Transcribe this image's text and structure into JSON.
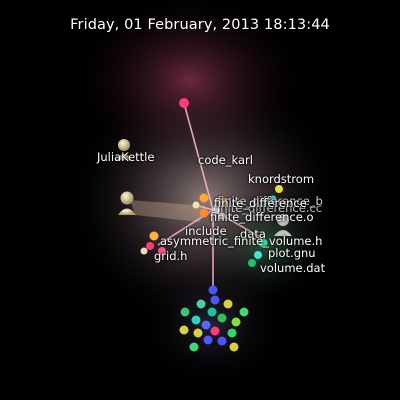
{
  "header": {
    "timestamp": "Friday, 01 February, 2013 18:13:44"
  },
  "users": {
    "julia": "JuliaKettle",
    "karl": "code_karl",
    "knordstrom": "knordstrom"
  },
  "files": {
    "finite_difference_a": "finite_difference",
    "finite_difference_o": "finite_difference.o",
    "include": "include",
    "data": "data",
    "asymmetric": "asymmetric_finite_volume.h",
    "gridh": "grid.h",
    "plot": "plot.gnu",
    "volume": "volume.dat",
    "overlap1": "finite_difference.cc",
    "overlap2": "finite_difference_b"
  },
  "colors": {
    "background": "#000000",
    "edge": "#ffb0b8",
    "user": "#e8d7a4",
    "node_pink": "#ff3b7a",
    "node_orange": "#ffa733",
    "node_blue": "#4b55ff",
    "node_green": "#39e07a",
    "node_yellow": "#d6d63a"
  }
}
